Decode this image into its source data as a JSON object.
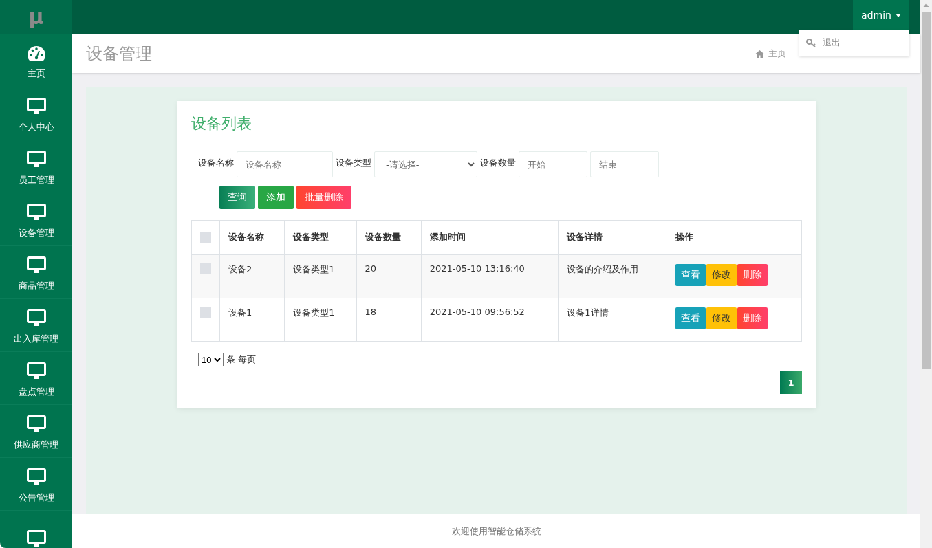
{
  "logo": "μ",
  "sidebar": {
    "items": [
      {
        "kind": "gauge",
        "label": "主页"
      },
      {
        "kind": "monitor",
        "label": "个人中心"
      },
      {
        "kind": "monitor",
        "label": "员工管理"
      },
      {
        "kind": "monitor",
        "label": "设备管理"
      },
      {
        "kind": "monitor",
        "label": "商品管理"
      },
      {
        "kind": "monitor",
        "label": "出入库管理"
      },
      {
        "kind": "monitor",
        "label": "盘点管理"
      },
      {
        "kind": "monitor",
        "label": "供应商管理"
      },
      {
        "kind": "monitor",
        "label": "公告管理"
      },
      {
        "kind": "monitor"
      }
    ]
  },
  "user_menu": {
    "label": "admin",
    "expanded": true,
    "items": [
      {
        "label": "退出"
      }
    ]
  },
  "page_title": "设备管理",
  "breadcrumb": [
    "主页"
  ],
  "card": {
    "title": "设备列表",
    "filters": [
      {
        "kind": "text",
        "label": "设备名称",
        "placeholder": "设备名称"
      },
      {
        "kind": "select",
        "label": "设备类型",
        "value": "-请选择-"
      },
      {
        "kind": "range",
        "label": "设备数量",
        "placeholder_from": "开始",
        "placeholder_to": "结束"
      }
    ],
    "buttons": [
      {
        "kind": "search",
        "label": "查询"
      },
      {
        "kind": "add",
        "label": "添加"
      },
      {
        "kind": "delete",
        "label": "批量删除"
      }
    ],
    "table": {
      "columns": [
        "设备名称",
        "设备类型",
        "设备数量",
        "添加时间",
        "设备详情",
        "操作"
      ],
      "header_checked": false,
      "rows": [
        {
          "checked": false,
          "cells": [
            "设备2",
            "设备类型1",
            "20",
            "2021-05-10 13:16:40",
            "设备的介绍及作用"
          ],
          "actions": [
            {
              "kind": "view",
              "label": "查看"
            },
            {
              "kind": "edit",
              "label": "修改"
            },
            {
              "kind": "delete",
              "label": "删除"
            }
          ]
        },
        {
          "checked": false,
          "cells": [
            "设备1",
            "设备类型1",
            "18",
            "2021-05-10 09:56:52",
            "设备1详情"
          ],
          "actions": [
            {
              "kind": "view",
              "label": "查看"
            },
            {
              "kind": "edit",
              "label": "修改"
            },
            {
              "kind": "delete",
              "label": "删除"
            }
          ]
        }
      ]
    },
    "page_size": "10",
    "page_size_label": "条 每页",
    "pages": [
      {
        "label": "1",
        "selected": true
      }
    ]
  },
  "footer": "欢迎使用智能仓储系统"
}
